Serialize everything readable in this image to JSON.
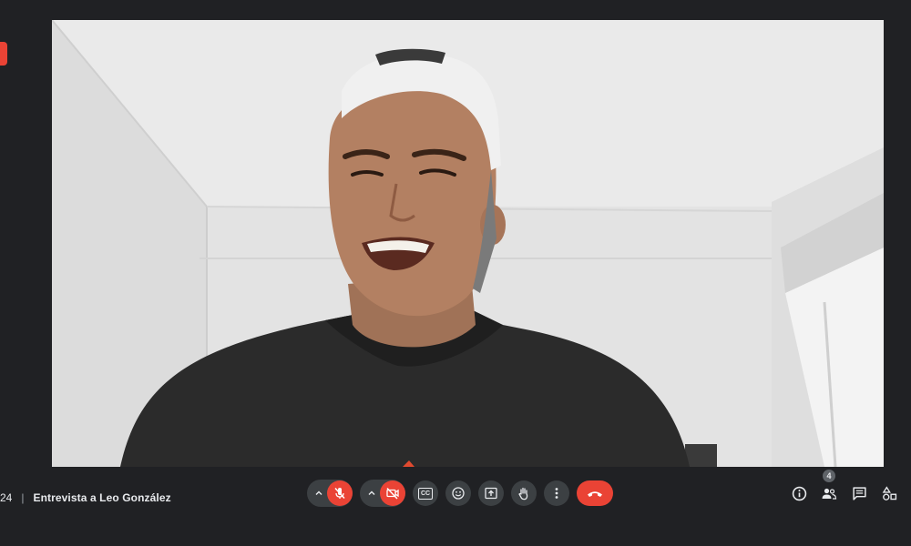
{
  "meeting": {
    "time_fragment": "24",
    "separator": "|",
    "title": "Entrevista a Leo González"
  },
  "participants": {
    "count": "4"
  },
  "controls": {
    "caption_label": "CC",
    "mic": "muted",
    "camera": "off"
  },
  "icons": {
    "mic": "mic-off-icon",
    "camera": "camera-off-icon",
    "captions": "captions-icon",
    "emoji": "emoji-icon",
    "present": "present-screen-icon",
    "hand": "raise-hand-icon",
    "more": "more-options-icon",
    "end": "end-call-icon",
    "info": "info-icon",
    "people": "people-icon",
    "chat": "chat-icon",
    "activities": "activities-icon"
  },
  "colors": {
    "background": "#202124",
    "control": "#3c4043",
    "danger": "#ea4335",
    "text": "#e8eaed"
  }
}
